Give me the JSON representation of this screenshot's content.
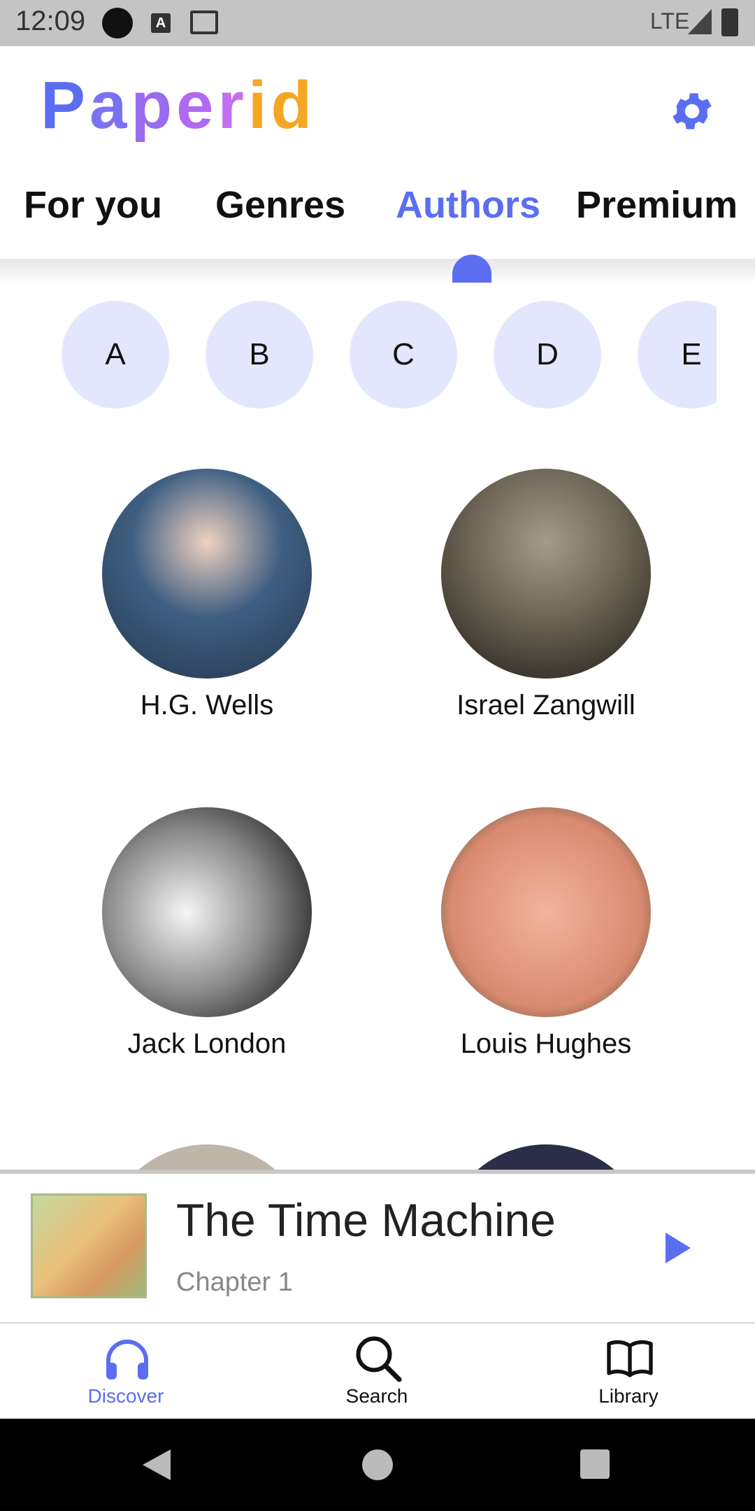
{
  "status_bar": {
    "time": "12:09",
    "network": "LTE"
  },
  "app": {
    "brand": "Paperid",
    "brand_colors": [
      "#5b6ef1",
      "#7a72f0",
      "#9a6cf0",
      "#b06af0",
      "#c36ef0",
      "#f5a623",
      "#f5a623"
    ]
  },
  "tabs": [
    {
      "label": "For you",
      "active": false
    },
    {
      "label": "Genres",
      "active": false
    },
    {
      "label": "Authors",
      "active": true
    },
    {
      "label": "Premium",
      "active": false
    }
  ],
  "letters": [
    "A",
    "B",
    "C",
    "D",
    "E"
  ],
  "authors": [
    {
      "name": "H.G. Wells",
      "avatar_colors": [
        "#f0d2c0",
        "#3f5f82",
        "#2e4560"
      ]
    },
    {
      "name": "Israel Zangwill",
      "avatar_colors": [
        "#a39c8c",
        "#6e6757",
        "#3c372f"
      ]
    },
    {
      "name": "Jack London",
      "avatar_colors": [
        "#f6f6f6",
        "#8a8a8a",
        "#1e1e1e"
      ]
    },
    {
      "name": "Louis Hughes",
      "avatar_colors": [
        "#f0b49e",
        "#d98a70",
        "#40503a"
      ]
    }
  ],
  "player": {
    "title": "The Time Machine",
    "subtitle": "Chapter 1"
  },
  "bottom_nav": [
    {
      "label": "Discover",
      "icon": "headphones-icon",
      "active": true
    },
    {
      "label": "Search",
      "icon": "search-icon",
      "active": false
    },
    {
      "label": "Library",
      "icon": "book-icon",
      "active": false
    }
  ],
  "colors": {
    "accent": "#5b6ef1",
    "letter_bg": "#e3e7fd",
    "brand_orange": "#f5a623"
  }
}
